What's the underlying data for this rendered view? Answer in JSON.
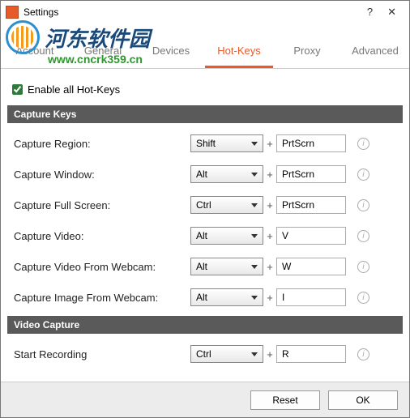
{
  "window": {
    "title": "Settings",
    "help": "?",
    "close": "✕"
  },
  "watermark": {
    "text": "河东软件园",
    "url": "www.cncrk359.cn"
  },
  "tabs": [
    "Account",
    "General",
    "Devices",
    "Hot-Keys",
    "Proxy",
    "Advanced"
  ],
  "active_tab": 3,
  "enable_all": {
    "label": "Enable all Hot-Keys",
    "checked": true
  },
  "sections": {
    "capture": {
      "header": "Capture Keys",
      "rows": [
        {
          "label": "Capture Region:",
          "mod": "Shift",
          "key": "PrtScrn"
        },
        {
          "label": "Capture Window:",
          "mod": "Alt",
          "key": "PrtScrn"
        },
        {
          "label": "Capture Full Screen:",
          "mod": "Ctrl",
          "key": "PrtScrn"
        },
        {
          "label": "Capture Video:",
          "mod": "Alt",
          "key": "V"
        },
        {
          "label": "Capture Video From Webcam:",
          "mod": "Alt",
          "key": "W"
        },
        {
          "label": "Capture Image From Webcam:",
          "mod": "Alt",
          "key": "I"
        }
      ]
    },
    "video": {
      "header": "Video Capture",
      "rows": [
        {
          "label": "Start Recording",
          "mod": "Ctrl",
          "key": "R"
        }
      ]
    }
  },
  "footer": {
    "reset": "Reset",
    "ok": "OK"
  }
}
